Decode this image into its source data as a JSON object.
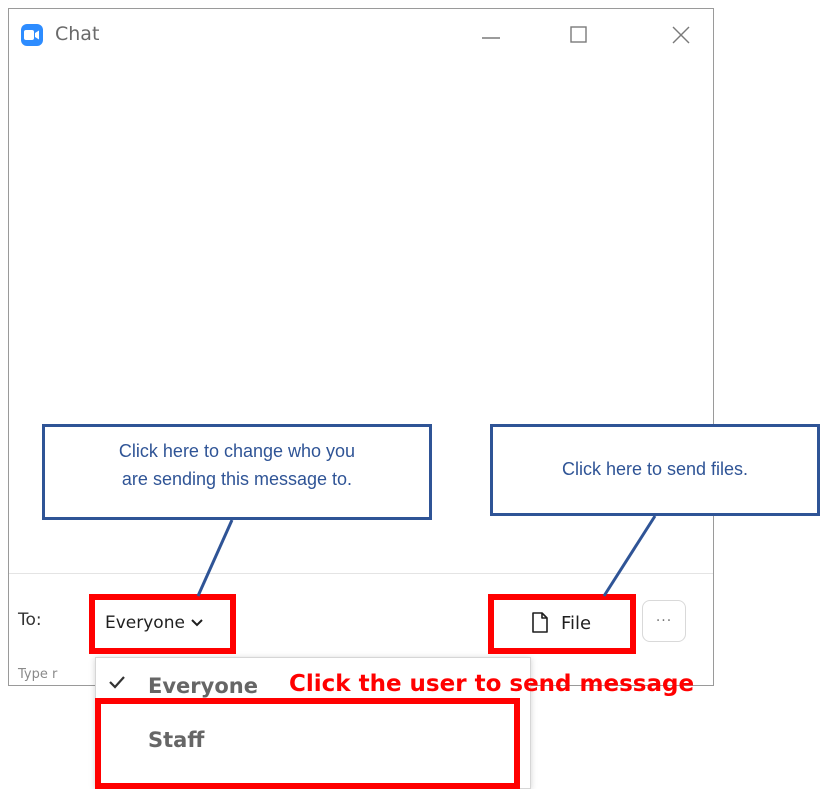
{
  "window": {
    "title": "Chat",
    "icon": "zoom-camera-icon",
    "controls": {
      "minimize": "minimize-icon",
      "maximize": "maximize-icon",
      "close": "close-icon"
    }
  },
  "footer": {
    "to_label": "To:",
    "recipient": "Everyone",
    "recipient_chevron": "chevron-down-icon",
    "file_label": "File",
    "file_icon": "file-icon",
    "more_label": "···",
    "input_placeholder": "Type r"
  },
  "menu": {
    "items": [
      {
        "label": "Everyone",
        "selected": true
      },
      {
        "label": "Staff",
        "selected": false
      }
    ]
  },
  "annotations": {
    "callout_recipient": "Click here to change who you are sending this message to.",
    "callout_recipient_line1": "Click here to change who you",
    "callout_recipient_line2": "are sending this message to.",
    "callout_file": "Click here to send files.",
    "red_note": "Click the user to send message",
    "highlight_color": "#ff0000",
    "callout_color": "#2f5496"
  }
}
